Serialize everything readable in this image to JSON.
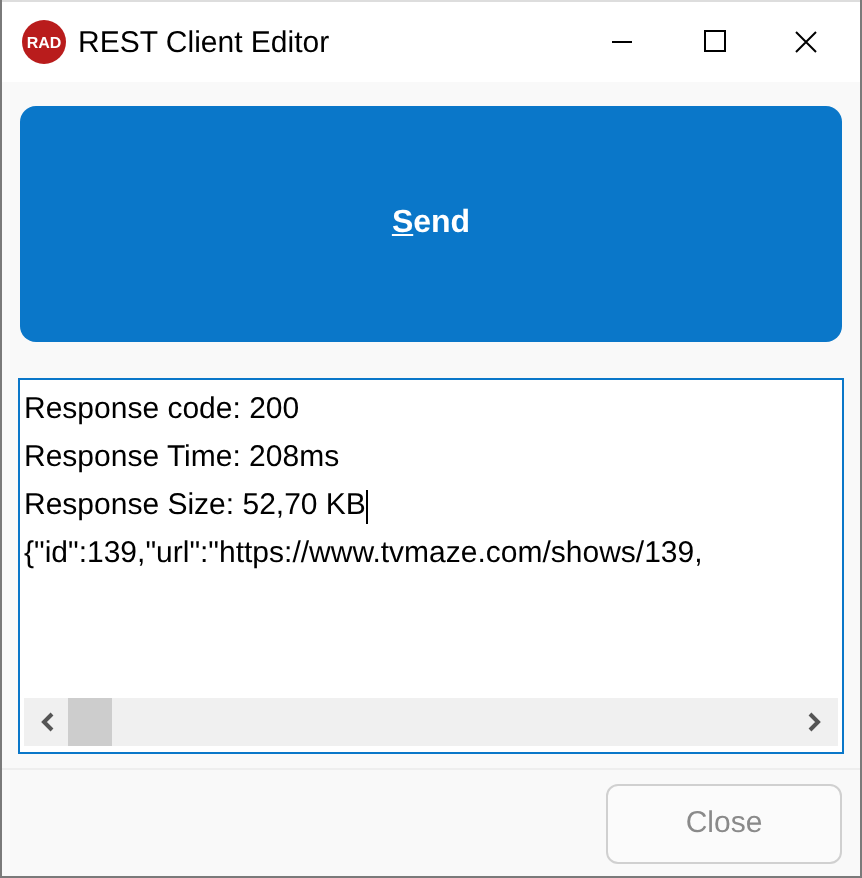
{
  "window": {
    "title": "REST Client Editor",
    "app_icon_text": "RAD"
  },
  "send_button": {
    "label": "Send",
    "disabled": false
  },
  "response": {
    "lines": [
      {
        "text": "Response code: 200",
        "caret": false
      },
      {
        "text": "Response Time: 208ms",
        "caret": false
      },
      {
        "text": "Response Size: 52,70 KB",
        "caret": true
      },
      {
        "text": "{\"id\":139,\"url\":\"https://www.tvmaze.com/shows/139,",
        "caret": false
      }
    ]
  },
  "close_button": {
    "label": "Close",
    "disabled": true
  }
}
